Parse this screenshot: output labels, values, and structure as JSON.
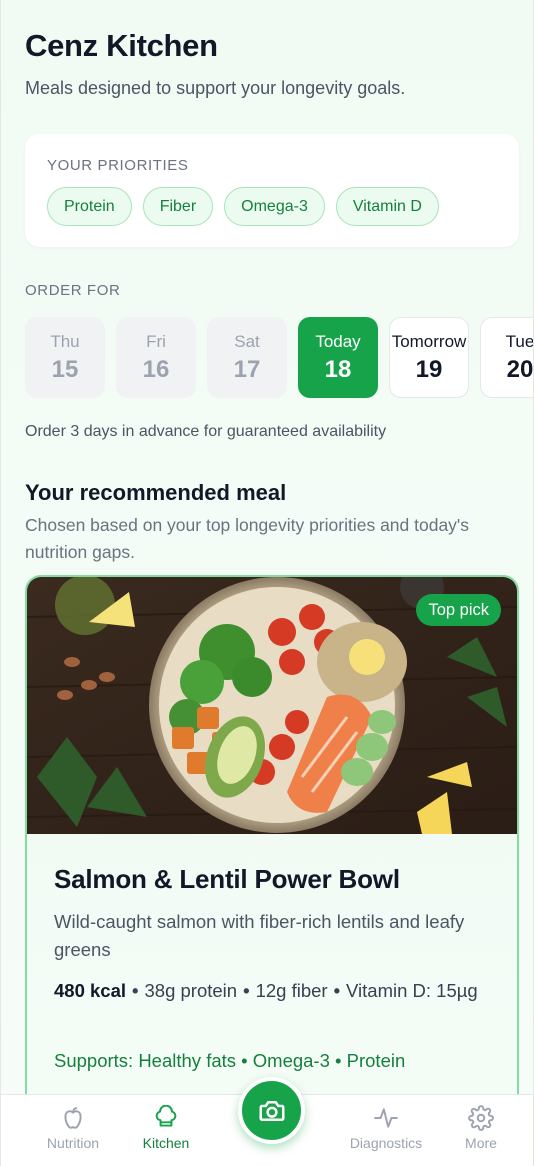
{
  "header": {
    "title": "Cenz Kitchen",
    "subtitle": "Meals designed to support your longevity goals."
  },
  "priorities": {
    "label": "YOUR PRIORITIES",
    "items": [
      "Protein",
      "Fiber",
      "Omega-3",
      "Vitamin D"
    ]
  },
  "order": {
    "label": "ORDER FOR",
    "days": [
      {
        "name": "Thu",
        "num": "15",
        "state": "past"
      },
      {
        "name": "Fri",
        "num": "16",
        "state": "past"
      },
      {
        "name": "Sat",
        "num": "17",
        "state": "past"
      },
      {
        "name": "Today",
        "num": "18",
        "state": "selected"
      },
      {
        "name": "Tomorrow",
        "num": "19",
        "state": "future"
      },
      {
        "name": "Tue",
        "num": "20",
        "state": "future"
      }
    ],
    "note": "Order 3 days in advance for guaranteed availability"
  },
  "recommendation": {
    "title": "Your recommended meal",
    "subtitle": "Chosen based on your top longevity priorities and today's nutrition gaps.",
    "meal": {
      "badge": "Top pick",
      "name": "Salmon & Lentil Power Bowl",
      "description": "Wild-caught salmon with fiber-rich lentils and leafy greens",
      "kcal": "480 kcal",
      "protein": "38g protein",
      "fiber": "12g fiber",
      "vitamin_d": "Vitamin D: 15µg",
      "supports": "Supports: Healthy fats • Omega-3 • Protein"
    }
  },
  "nav": {
    "items": [
      {
        "label": "Nutrition",
        "icon": "apple-icon",
        "active": false
      },
      {
        "label": "Kitchen",
        "icon": "chef-hat-icon",
        "active": true
      },
      {
        "label": "Diagnostics",
        "icon": "activity-icon",
        "active": false
      },
      {
        "label": "More",
        "icon": "gear-icon",
        "active": false
      }
    ],
    "center_icon": "camera-icon"
  },
  "colors": {
    "accent": "#16a34a",
    "accent_text": "#15803d",
    "background": "#f1fbf4"
  }
}
